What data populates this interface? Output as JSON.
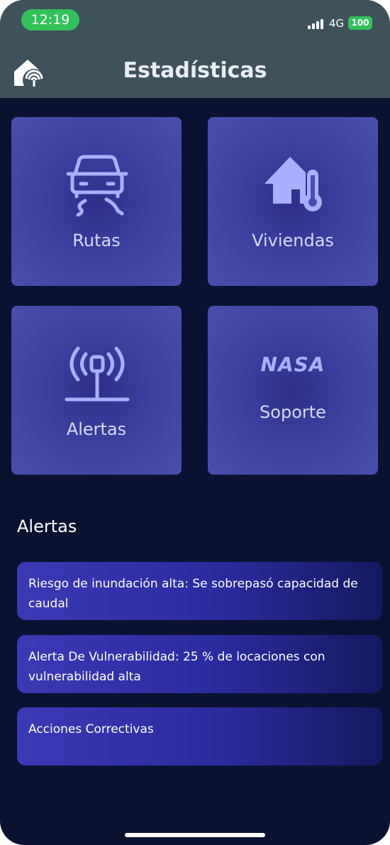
{
  "status": {
    "time": "12:19",
    "network": "4G",
    "battery": "100"
  },
  "header": {
    "title": "Estadísticas"
  },
  "tiles": [
    {
      "label": "Rutas",
      "icon": "car-road-icon"
    },
    {
      "label": "Viviendas",
      "icon": "house-thermometer-icon"
    },
    {
      "label": "Alertas",
      "icon": "antenna-icon"
    },
    {
      "label": "Soporte",
      "icon": "nasa-logo"
    }
  ],
  "logo_text": "NASA",
  "alerts": {
    "title": "Alertas",
    "items": [
      "Riesgo de inundación alta: Se sobrepasó capacidad de caudal",
      "Alerta De Vulnerabilidad: 25 % de locaciones con vulnerabilidad alta",
      "Acciones Correctivas"
    ]
  },
  "colors": {
    "header": "#3f525c",
    "background": "#0a1230",
    "tile": "#4a4fad",
    "alert_card": "#3b39b4",
    "status_green": "#33c25a"
  }
}
